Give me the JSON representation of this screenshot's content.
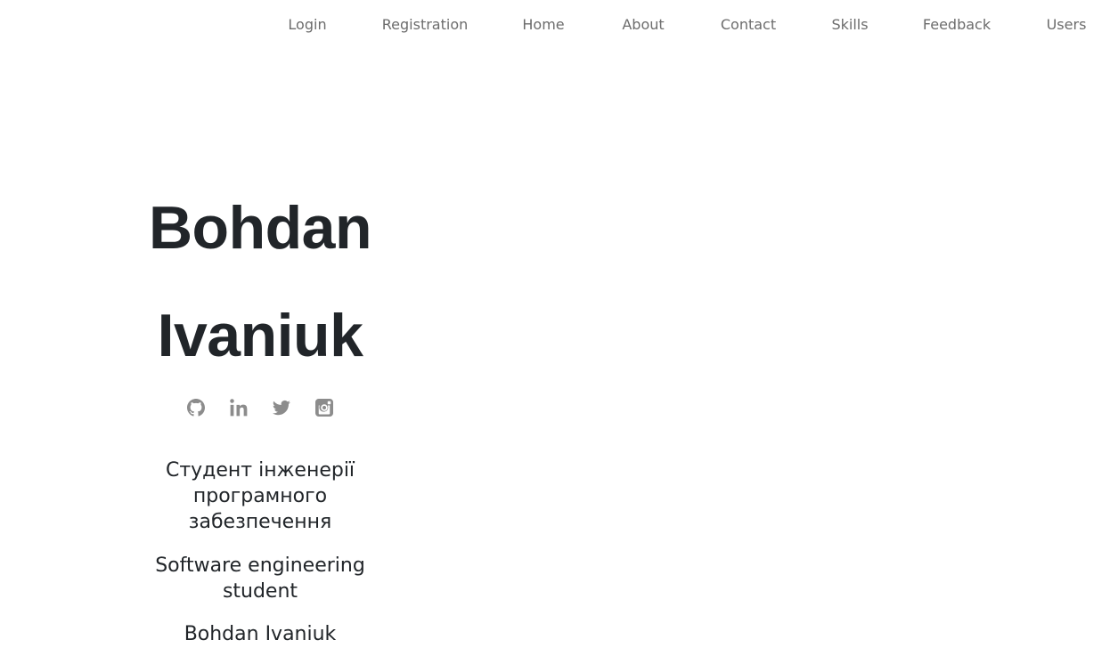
{
  "nav": {
    "items": [
      {
        "label": "Login"
      },
      {
        "label": "Registration"
      },
      {
        "label": "Home"
      },
      {
        "label": "About"
      },
      {
        "label": "Contact"
      },
      {
        "label": "Skills"
      },
      {
        "label": "Feedback"
      },
      {
        "label": "Users"
      }
    ]
  },
  "profile": {
    "first_name": "Bohdan",
    "last_name": "Ivaniuk",
    "socials": [
      {
        "icon": "github-icon"
      },
      {
        "icon": "linkedin-icon"
      },
      {
        "icon": "twitter-icon"
      },
      {
        "icon": "instagram-icon"
      }
    ],
    "subtitle_ua": "Студент інженерії програмного забезпечення",
    "subtitle_en": "Software engineering student",
    "subtitle_name": "Bohdan Ivaniuk"
  },
  "colors": {
    "nav_text": "#6c6c6c",
    "heading": "#212529",
    "icon": "#8c8c8c",
    "background": "#ffffff"
  }
}
